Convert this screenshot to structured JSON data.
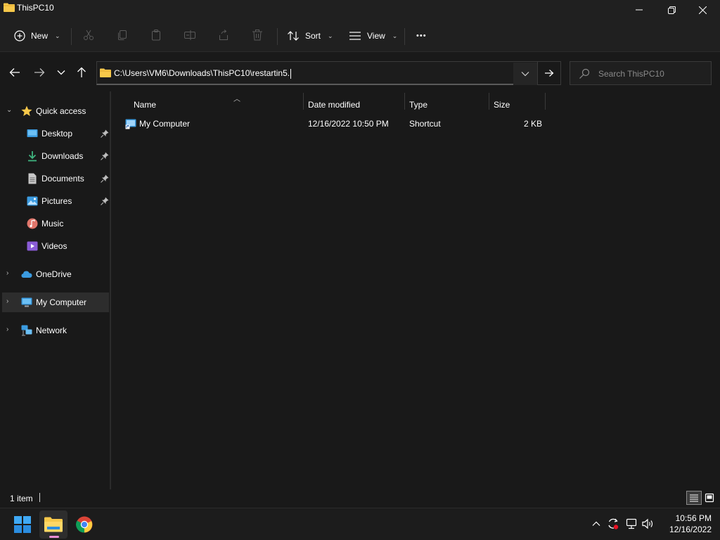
{
  "window": {
    "title": "ThisPC10"
  },
  "command_bar": {
    "new_label": "New",
    "sort_label": "Sort",
    "view_label": "View",
    "more_label": "•••"
  },
  "address": {
    "path": "C:\\Users\\VM6\\Downloads\\ThisPC10\\restartin5.",
    "search_placeholder": "Search ThisPC10"
  },
  "sidebar": {
    "items": [
      {
        "label": "Quick access",
        "icon": "star-icon"
      },
      {
        "label": "Desktop",
        "icon": "desktop-icon",
        "pinned": true
      },
      {
        "label": "Downloads",
        "icon": "download-icon",
        "pinned": true
      },
      {
        "label": "Documents",
        "icon": "document-icon",
        "pinned": true
      },
      {
        "label": "Pictures",
        "icon": "picture-icon",
        "pinned": true
      },
      {
        "label": "Music",
        "icon": "music-icon"
      },
      {
        "label": "Videos",
        "icon": "video-icon"
      },
      {
        "label": "OneDrive",
        "icon": "cloud-icon"
      },
      {
        "label": "My Computer",
        "icon": "computer-icon",
        "selected": true
      },
      {
        "label": "Network",
        "icon": "network-icon"
      }
    ]
  },
  "file_list": {
    "columns": [
      "Name",
      "Date modified",
      "Type",
      "Size"
    ],
    "sorted_by": "Name",
    "rows": [
      {
        "name": "My Computer",
        "date_modified": "12/16/2022 10:50 PM",
        "type": "Shortcut",
        "size": "2 KB"
      }
    ]
  },
  "status": {
    "item_count": "1 item"
  },
  "taskbar": {
    "time": "10:56 PM",
    "date": "12/16/2022",
    "apps": [
      "start-icon",
      "file-explorer-icon",
      "chrome-icon"
    ]
  },
  "colors": {
    "background": "#191919",
    "folder": "#f7c84a",
    "accent": "#4cc2ff",
    "active_indicator": "#e88cd4"
  }
}
